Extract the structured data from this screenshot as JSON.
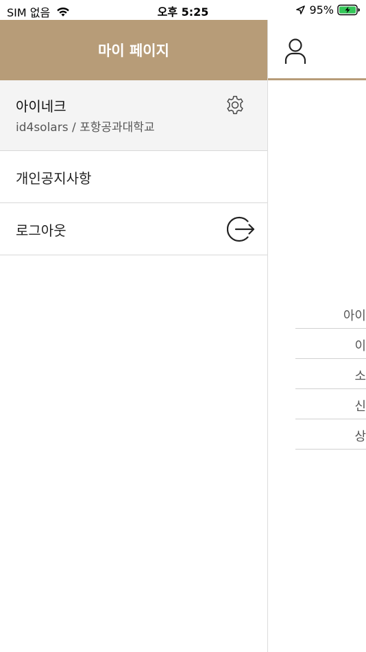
{
  "status_bar": {
    "carrier": "SIM 없음",
    "time": "오후 5:25",
    "battery": "95%"
  },
  "drawer": {
    "title": "마이 페이지",
    "profile": {
      "name": "아이네크",
      "subtitle": "id4solars / 포항공과대학교"
    },
    "menu": [
      {
        "label": "개인공지사항"
      },
      {
        "label": "로그아웃"
      }
    ]
  },
  "main": {
    "items": [
      "아이",
      "이",
      "소",
      "신",
      "상"
    ]
  },
  "colors": {
    "header_brown": "#b79c78"
  }
}
